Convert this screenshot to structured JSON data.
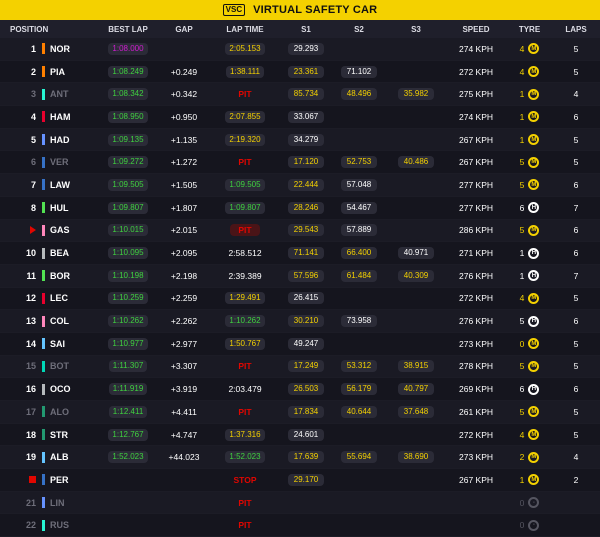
{
  "banner": {
    "badge": "VSC",
    "text": "VIRTUAL SAFETY CAR"
  },
  "headers": [
    "POSITION",
    "BEST LAP",
    "GAP",
    "LAP TIME",
    "S1",
    "S2",
    "S3",
    "SPEED",
    "TYRE",
    "LAPS"
  ],
  "colors": {
    "vsc": "#f4d100",
    "green": "#3fd13f",
    "purple": "#d01cd0",
    "yellow": "#f4d100",
    "pit": "#e10600",
    "medium": "#f4d100",
    "hard": "#ffffff",
    "soft": "#e10600"
  },
  "rows": [
    {
      "pos": "1",
      "code": "NOR",
      "team": "#ff8000",
      "out": false,
      "best": "1:08.000",
      "best_c": "purple",
      "gap": "",
      "lt": "2:05.153",
      "lt_c": "yellow",
      "s1": "29.293",
      "s1_c": "white",
      "s2": "",
      "s2_c": "",
      "s3": "",
      "s3_c": "",
      "speed": "274 KPH",
      "age": "4",
      "age_c": "yellow",
      "tyre": "M",
      "tyre_icon": "medium-tyre-icon",
      "laps": "5"
    },
    {
      "pos": "2",
      "code": "PIA",
      "team": "#ff8000",
      "out": false,
      "best": "1:08.249",
      "best_c": "green",
      "gap": "+0.249",
      "lt": "1:38.111",
      "lt_c": "yellow",
      "s1": "23.361",
      "s1_c": "yellow",
      "s2": "71.102",
      "s2_c": "white",
      "s3": "",
      "s3_c": "",
      "speed": "272 KPH",
      "age": "4",
      "age_c": "yellow",
      "tyre": "M",
      "tyre_icon": "medium-tyre-icon",
      "laps": "5"
    },
    {
      "pos": "3",
      "code": "ANT",
      "team": "#27f4d2",
      "out": true,
      "best": "1:08.342",
      "best_c": "green",
      "gap": "+0.342",
      "lt": "PIT",
      "lt_c": "pit",
      "s1": "85.734",
      "s1_c": "yellow",
      "s2": "48.496",
      "s2_c": "yellow",
      "s3": "35.982",
      "s3_c": "yellow",
      "speed": "275 KPH",
      "age": "1",
      "age_c": "yellow",
      "tyre": "M",
      "tyre_icon": "medium-tyre-icon",
      "laps": "4"
    },
    {
      "pos": "4",
      "code": "HAM",
      "team": "#e8002d",
      "out": false,
      "best": "1:08.950",
      "best_c": "green",
      "gap": "+0.950",
      "lt": "2:07.855",
      "lt_c": "yellow",
      "s1": "33.067",
      "s1_c": "white",
      "s2": "",
      "s2_c": "",
      "s3": "",
      "s3_c": "",
      "speed": "274 KPH",
      "age": "1",
      "age_c": "yellow",
      "tyre": "M",
      "tyre_icon": "medium-tyre-icon",
      "laps": "6"
    },
    {
      "pos": "5",
      "code": "HAD",
      "team": "#6692ff",
      "out": false,
      "best": "1:09.135",
      "best_c": "green",
      "gap": "+1.135",
      "lt": "2:19.320",
      "lt_c": "yellow",
      "s1": "34.279",
      "s1_c": "white",
      "s2": "",
      "s2_c": "",
      "s3": "",
      "s3_c": "",
      "speed": "267 KPH",
      "age": "1",
      "age_c": "yellow",
      "tyre": "M",
      "tyre_icon": "medium-tyre-icon",
      "laps": "5"
    },
    {
      "pos": "6",
      "code": "VER",
      "team": "#3671c6",
      "out": true,
      "best": "1:09.272",
      "best_c": "green",
      "gap": "+1.272",
      "lt": "PIT",
      "lt_c": "pit",
      "s1": "17.120",
      "s1_c": "yellow",
      "s2": "52.753",
      "s2_c": "yellow",
      "s3": "40.486",
      "s3_c": "yellow",
      "speed": "267 KPH",
      "age": "5",
      "age_c": "yellow",
      "tyre": "M",
      "tyre_icon": "medium-tyre-icon",
      "laps": "5"
    },
    {
      "pos": "7",
      "code": "LAW",
      "team": "#3671c6",
      "out": false,
      "best": "1:09.505",
      "best_c": "green",
      "gap": "+1.505",
      "lt": "1:09.505",
      "lt_c": "green",
      "s1": "22.444",
      "s1_c": "yellow",
      "s2": "57.048",
      "s2_c": "white",
      "s3": "",
      "s3_c": "",
      "speed": "277 KPH",
      "age": "5",
      "age_c": "yellow",
      "tyre": "M",
      "tyre_icon": "medium-tyre-icon",
      "laps": "6"
    },
    {
      "pos": "8",
      "code": "HUL",
      "team": "#52e252",
      "out": false,
      "best": "1:09.807",
      "best_c": "green",
      "gap": "+1.807",
      "lt": "1:09.807",
      "lt_c": "green",
      "s1": "28.246",
      "s1_c": "yellow",
      "s2": "54.467",
      "s2_c": "white",
      "s3": "",
      "s3_c": "",
      "speed": "277 KPH",
      "age": "6",
      "age_c": "white",
      "tyre": "H",
      "tyre_icon": "hard-tyre-icon",
      "laps": "7"
    },
    {
      "pos": "",
      "code": "GAS",
      "team": "#ff87bc",
      "out": false,
      "marker": "tri",
      "best": "1:10.015",
      "best_c": "green",
      "gap": "+2.015",
      "lt": "PIT",
      "lt_c": "pitbg",
      "s1": "29.543",
      "s1_c": "yellow",
      "s2": "57.889",
      "s2_c": "white",
      "s3": "",
      "s3_c": "",
      "speed": "286 KPH",
      "age": "5",
      "age_c": "yellow",
      "tyre": "M",
      "tyre_icon": "medium-tyre-icon",
      "laps": "6"
    },
    {
      "pos": "10",
      "code": "BEA",
      "team": "#b6babd",
      "out": false,
      "best": "1:10.095",
      "best_c": "green",
      "gap": "+2.095",
      "lt": "2:58.512",
      "lt_c": "white",
      "s1": "71.141",
      "s1_c": "yellow",
      "s2": "66.400",
      "s2_c": "yellow",
      "s3": "40.971",
      "s3_c": "white",
      "speed": "271 KPH",
      "age": "1",
      "age_c": "white",
      "tyre": "H",
      "tyre_icon": "hard-tyre-icon",
      "laps": "6"
    },
    {
      "pos": "11",
      "code": "BOR",
      "team": "#52e252",
      "out": false,
      "best": "1:10.198",
      "best_c": "green",
      "gap": "+2.198",
      "lt": "2:39.389",
      "lt_c": "white",
      "s1": "57.596",
      "s1_c": "yellow",
      "s2": "61.484",
      "s2_c": "yellow",
      "s3": "40.309",
      "s3_c": "yellow",
      "speed": "276 KPH",
      "age": "1",
      "age_c": "white",
      "tyre": "H",
      "tyre_icon": "hard-tyre-icon",
      "laps": "7"
    },
    {
      "pos": "12",
      "code": "LEC",
      "team": "#e8002d",
      "out": false,
      "best": "1:10.259",
      "best_c": "green",
      "gap": "+2.259",
      "lt": "1:29.491",
      "lt_c": "yellow",
      "s1": "26.415",
      "s1_c": "white",
      "s2": "",
      "s2_c": "",
      "s3": "",
      "s3_c": "",
      "speed": "272 KPH",
      "age": "4",
      "age_c": "yellow",
      "tyre": "M",
      "tyre_icon": "medium-tyre-icon",
      "laps": "5"
    },
    {
      "pos": "13",
      "code": "COL",
      "team": "#ff87bc",
      "out": false,
      "best": "1:10.262",
      "best_c": "green",
      "gap": "+2.262",
      "lt": "1:10.262",
      "lt_c": "green",
      "s1": "30.210",
      "s1_c": "yellow",
      "s2": "73.958",
      "s2_c": "white",
      "s3": "",
      "s3_c": "",
      "speed": "276 KPH",
      "age": "5",
      "age_c": "white",
      "tyre": "H",
      "tyre_icon": "hard-tyre-icon",
      "laps": "6"
    },
    {
      "pos": "14",
      "code": "SAI",
      "team": "#64c4ff",
      "out": false,
      "best": "1:10.977",
      "best_c": "green",
      "gap": "+2.977",
      "lt": "1:50.767",
      "lt_c": "yellow",
      "s1": "49.247",
      "s1_c": "white",
      "s2": "",
      "s2_c": "",
      "s3": "",
      "s3_c": "",
      "speed": "273 KPH",
      "age": "0",
      "age_c": "yellow",
      "tyre": "M",
      "tyre_icon": "medium-tyre-icon",
      "laps": "5"
    },
    {
      "pos": "15",
      "code": "BOT",
      "team": "#00d7b6",
      "out": true,
      "best": "1:11.307",
      "best_c": "green",
      "gap": "+3.307",
      "lt": "PIT",
      "lt_c": "pit",
      "s1": "17.249",
      "s1_c": "yellow",
      "s2": "53.312",
      "s2_c": "yellow",
      "s3": "38.915",
      "s3_c": "yellow",
      "speed": "278 KPH",
      "age": "5",
      "age_c": "yellow",
      "tyre": "M",
      "tyre_icon": "medium-tyre-icon",
      "laps": "5"
    },
    {
      "pos": "16",
      "code": "OCO",
      "team": "#b6babd",
      "out": false,
      "best": "1:11.919",
      "best_c": "green",
      "gap": "+3.919",
      "lt": "2:03.479",
      "lt_c": "white",
      "s1": "26.503",
      "s1_c": "yellow",
      "s2": "56.179",
      "s2_c": "yellow",
      "s3": "40.797",
      "s3_c": "yellow",
      "speed": "269 KPH",
      "age": "6",
      "age_c": "white",
      "tyre": "H",
      "tyre_icon": "hard-tyre-icon",
      "laps": "6"
    },
    {
      "pos": "17",
      "code": "ALO",
      "team": "#229971",
      "out": true,
      "best": "1:12.411",
      "best_c": "green",
      "gap": "+4.411",
      "lt": "PIT",
      "lt_c": "pit",
      "s1": "17.834",
      "s1_c": "yellow",
      "s2": "40.644",
      "s2_c": "yellow",
      "s3": "37.648",
      "s3_c": "yellow",
      "speed": "261 KPH",
      "age": "5",
      "age_c": "yellow",
      "tyre": "M",
      "tyre_icon": "medium-tyre-icon",
      "laps": "5"
    },
    {
      "pos": "18",
      "code": "STR",
      "team": "#229971",
      "out": false,
      "best": "1:12.767",
      "best_c": "green",
      "gap": "+4.747",
      "lt": "1:37.316",
      "lt_c": "yellow",
      "s1": "24.601",
      "s1_c": "white",
      "s2": "",
      "s2_c": "",
      "s3": "",
      "s3_c": "",
      "speed": "272 KPH",
      "age": "4",
      "age_c": "yellow",
      "tyre": "M",
      "tyre_icon": "medium-tyre-icon",
      "laps": "5"
    },
    {
      "pos": "19",
      "code": "ALB",
      "team": "#64c4ff",
      "out": false,
      "best": "1:52.023",
      "best_c": "green",
      "gap": "+44.023",
      "lt": "1:52.023",
      "lt_c": "green",
      "s1": "17.639",
      "s1_c": "yellow",
      "s2": "55.694",
      "s2_c": "yellow",
      "s3": "38.690",
      "s3_c": "yellow",
      "speed": "273 KPH",
      "age": "2",
      "age_c": "yellow",
      "tyre": "M",
      "tyre_icon": "medium-tyre-icon",
      "laps": "4"
    },
    {
      "pos": "",
      "code": "PER",
      "team": "#3671c6",
      "out": false,
      "marker": "stop",
      "best": "",
      "best_c": "",
      "gap": "",
      "lt": "STOP",
      "lt_c": "pit",
      "s1": "29.170",
      "s1_c": "yellow",
      "s2": "",
      "s2_c": "",
      "s3": "",
      "s3_c": "",
      "speed": "267 KPH",
      "age": "1",
      "age_c": "yellow",
      "tyre": "M",
      "tyre_icon": "medium-tyre-icon",
      "laps": "2"
    },
    {
      "pos": "21",
      "code": "LIN",
      "team": "#6692ff",
      "out": true,
      "best": "",
      "best_c": "",
      "gap": "",
      "lt": "PIT",
      "lt_c": "pit",
      "s1": "",
      "s1_c": "",
      "s2": "",
      "s2_c": "",
      "s3": "",
      "s3_c": "",
      "speed": "",
      "age": "0",
      "age_c": "dim",
      "tyre": "-",
      "tyre_icon": "unknown-tyre-icon",
      "laps": ""
    },
    {
      "pos": "22",
      "code": "RUS",
      "team": "#27f4d2",
      "out": true,
      "best": "",
      "best_c": "",
      "gap": "",
      "lt": "PIT",
      "lt_c": "pit",
      "s1": "",
      "s1_c": "",
      "s2": "",
      "s2_c": "",
      "s3": "",
      "s3_c": "",
      "speed": "",
      "age": "0",
      "age_c": "dim",
      "tyre": "-",
      "tyre_icon": "unknown-tyre-icon",
      "laps": ""
    }
  ]
}
